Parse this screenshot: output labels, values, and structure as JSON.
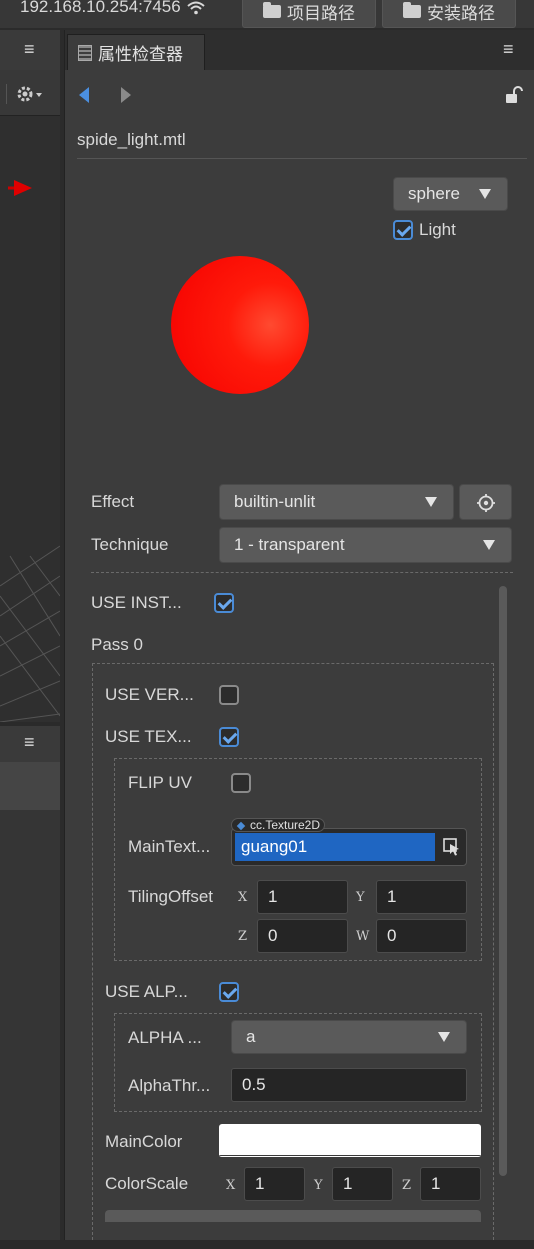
{
  "topbar": {
    "address": "192.168.10.254:7456",
    "project_path_label": "项目路径",
    "install_path_label": "安装路径"
  },
  "left_panel": {
    "menu_glyph": "≡"
  },
  "inspector": {
    "tab_title": "属性检查器",
    "menu_glyph": "≡",
    "asset_name": "spide_light.mtl",
    "preview": {
      "shape_option": "sphere",
      "light_label": "Light",
      "light_checked": true,
      "sphere_color": "#ff1a0a"
    },
    "effect": {
      "label": "Effect",
      "value": "builtin-unlit"
    },
    "technique": {
      "label": "Technique",
      "value": "1 - transparent"
    },
    "use_instancing": {
      "label": "USE  INST...",
      "checked": true
    },
    "pass_label": "Pass 0",
    "use_vertex": {
      "label": "USE  VER...",
      "checked": false
    },
    "use_texture": {
      "label": "USE  TEX...",
      "checked": true
    },
    "flip_uv": {
      "label": "FLIP  UV",
      "checked": false
    },
    "main_texture": {
      "label": "MainText...",
      "type_tag": "cc.Texture2D",
      "value": "guang01"
    },
    "tiling_offset": {
      "label": "TilingOffset",
      "x_label": "X",
      "x": "1",
      "y_label": "Y",
      "y": "1",
      "z_label": "Z",
      "z": "0",
      "w_label": "W",
      "w": "0"
    },
    "use_alpha": {
      "label": "USE  ALP...",
      "checked": true
    },
    "alpha_source": {
      "label": "ALPHA  ...",
      "value": "a"
    },
    "alpha_threshold": {
      "label": "AlphaThr...",
      "value": "0.5"
    },
    "main_color": {
      "label": "MainColor",
      "value": "#ffffff"
    },
    "color_scale": {
      "label": "ColorScale",
      "x_label": "X",
      "x": "1",
      "y_label": "Y",
      "y": "1",
      "z_label": "Z",
      "z": "1"
    }
  }
}
